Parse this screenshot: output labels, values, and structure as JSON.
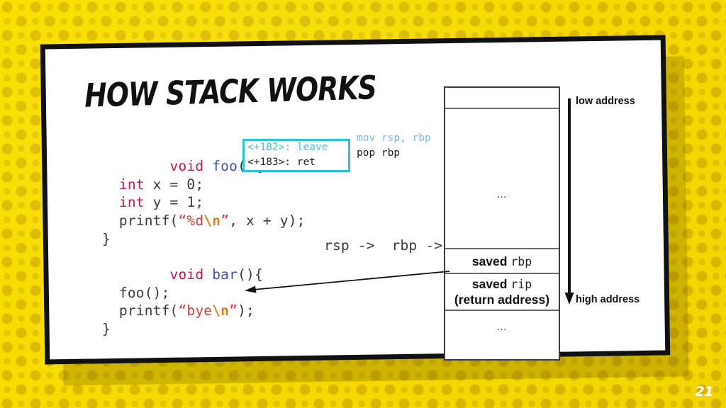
{
  "slide": {
    "title": "How Stack Works",
    "page_number": "21",
    "background_color": "#f7dc00",
    "accent_color": "#2ec2d8",
    "card_color": "#ffffff"
  },
  "code_foo": {
    "lines": [
      [
        {
          "t": "void ",
          "c": "type"
        },
        {
          "t": "foo",
          "c": "fn"
        },
        {
          "t": "(){",
          "c": "plain"
        }
      ],
      [
        {
          "t": "  int ",
          "c": "type"
        },
        {
          "t": "x = 0;",
          "c": "plain"
        }
      ],
      [
        {
          "t": "  int ",
          "c": "type"
        },
        {
          "t": "y = 1;",
          "c": "plain"
        }
      ],
      [
        {
          "t": "  printf(",
          "c": "plain"
        },
        {
          "t": "“%d",
          "c": "str"
        },
        {
          "t": "\\n",
          "c": "esc"
        },
        {
          "t": "”",
          "c": "str"
        },
        {
          "t": ", x + y);",
          "c": "plain"
        }
      ],
      [
        {
          "t": "}",
          "c": "plain"
        }
      ]
    ]
  },
  "code_bar": {
    "lines": [
      [
        {
          "t": "void ",
          "c": "type"
        },
        {
          "t": "bar",
          "c": "fn"
        },
        {
          "t": "(){",
          "c": "plain"
        }
      ],
      [
        {
          "t": "  foo();",
          "c": "plain"
        }
      ],
      [
        {
          "t": "  printf(",
          "c": "plain"
        },
        {
          "t": "“bye",
          "c": "str"
        },
        {
          "t": "\\n",
          "c": "esc"
        },
        {
          "t": "”",
          "c": "str"
        },
        {
          "t": ");",
          "c": "plain"
        }
      ],
      [
        {
          "t": "}",
          "c": "plain"
        }
      ]
    ]
  },
  "asm_box": {
    "line1_teal": "<+182>: leave",
    "line2": "<+183>: ret"
  },
  "asm_right": {
    "line1_lightblue": "mov rsp, rbp",
    "line2": "pop rbp"
  },
  "pointers": {
    "labels": "rsp ->  rbp ->"
  },
  "stack": {
    "cells": [
      {
        "name": "top-empty",
        "text": ""
      },
      {
        "name": "upper-region",
        "text": "…"
      },
      {
        "name": "saved-rbp",
        "bold": "saved ",
        "mono": "rbp"
      },
      {
        "name": "saved-rip",
        "bold": "saved ",
        "mono": "rip",
        "sub": "(return address)"
      },
      {
        "name": "lower-region",
        "text": "…"
      }
    ]
  },
  "address_axis": {
    "low_label": "low address",
    "high_label": "high address"
  }
}
